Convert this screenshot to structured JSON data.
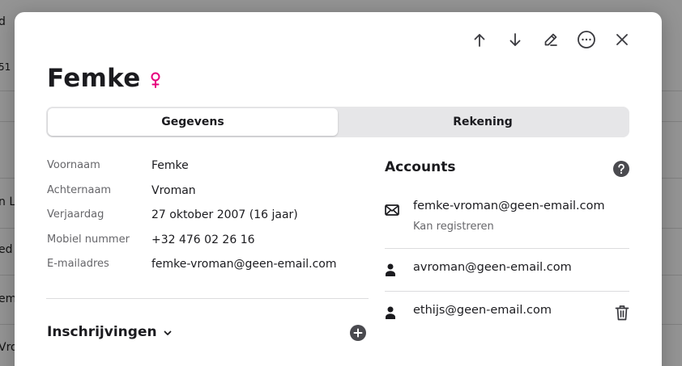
{
  "background": {
    "fragments": [
      "d",
      "51",
      "n L",
      "ed",
      "em",
      "Vro"
    ]
  },
  "toolbar": {
    "icons": [
      "arrow-up-icon",
      "arrow-down-icon",
      "edit-icon",
      "more-icon",
      "close-icon"
    ]
  },
  "person": {
    "name": "Femke",
    "gender_symbol": "♀",
    "gender_color": "#e6007e"
  },
  "tabs": [
    {
      "label": "Gegevens",
      "active": true
    },
    {
      "label": "Rekening",
      "active": false
    }
  ],
  "details": [
    {
      "label": "Voornaam",
      "value": "Femke"
    },
    {
      "label": "Achternaam",
      "value": "Vroman"
    },
    {
      "label": "Verjaardag",
      "value": "27 oktober 2007 (16 jaar)"
    },
    {
      "label": "Mobiel nummer",
      "value": "+32 476 02 26 16"
    },
    {
      "label": "E-mailadres",
      "value": "femke-vroman@geen-email.com"
    }
  ],
  "registrations": {
    "title": "Inschrijvingen"
  },
  "accounts": {
    "title": "Accounts",
    "items": [
      {
        "icon": "envelope-icon",
        "email": "femke-vroman@geen-email.com",
        "sub": "Kan registreren"
      },
      {
        "icon": "user-icon",
        "email": "avroman@geen-email.com",
        "sub": ""
      },
      {
        "icon": "user-icon",
        "email": "ethijs@geen-email.com",
        "sub": "",
        "deletable": true
      }
    ]
  }
}
